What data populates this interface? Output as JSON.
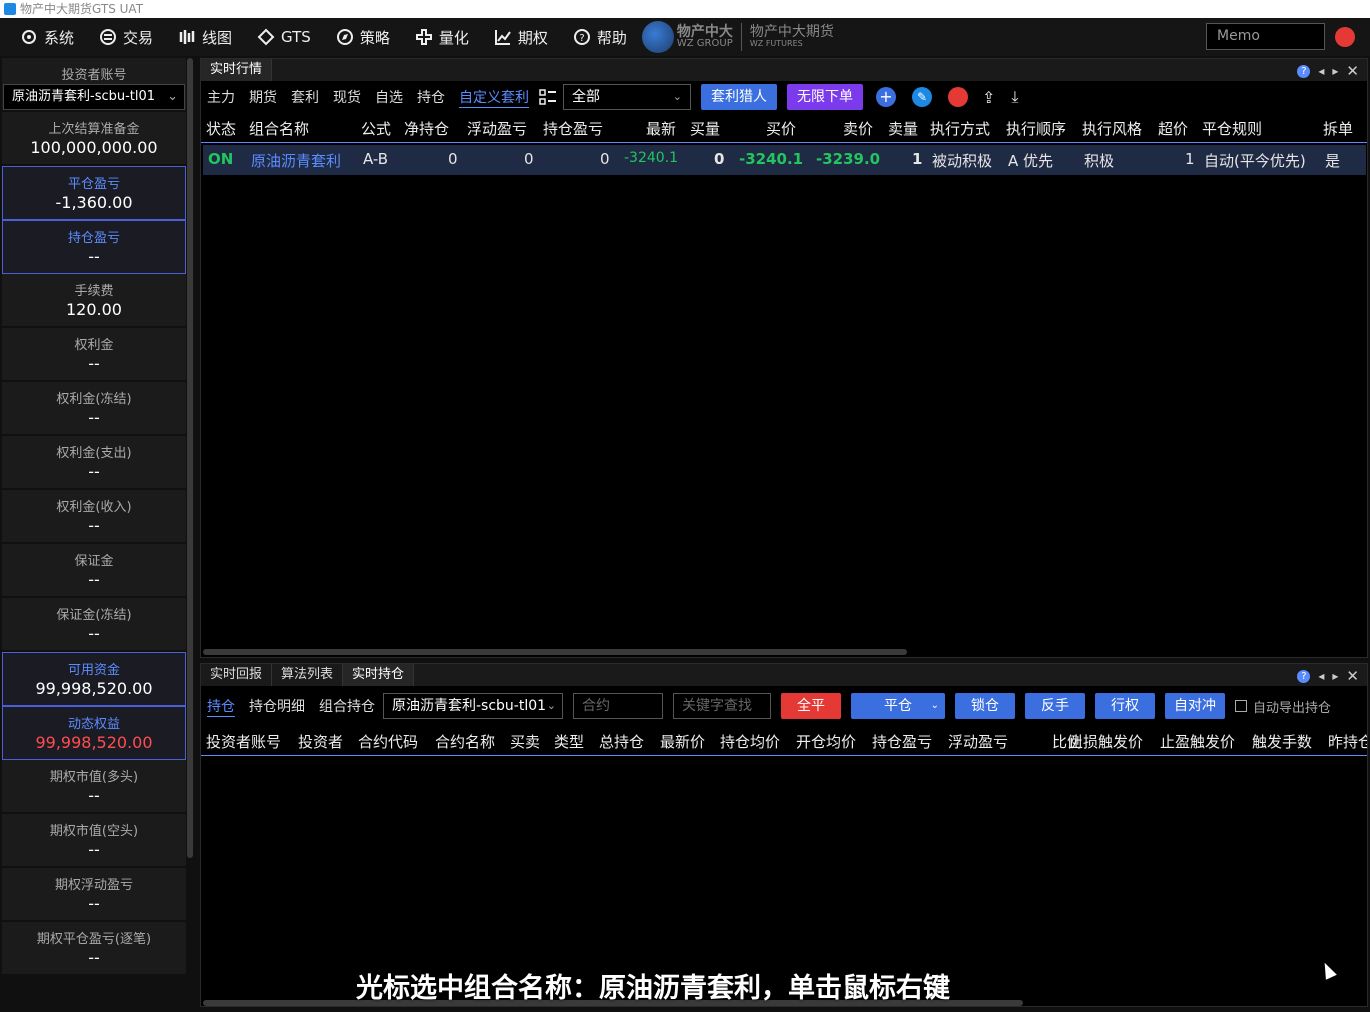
{
  "window": {
    "title": "物产中大期货GTS UAT"
  },
  "menu": [
    {
      "label": "系统",
      "icon": "gear-icon"
    },
    {
      "label": "交易",
      "icon": "exchange-icon"
    },
    {
      "label": "线图",
      "icon": "candlestick-icon"
    },
    {
      "label": "GTS",
      "icon": "diamond-icon"
    },
    {
      "label": "策略",
      "icon": "compass-icon"
    },
    {
      "label": "量化",
      "icon": "quant-icon"
    },
    {
      "label": "期权",
      "icon": "chart-line-icon"
    },
    {
      "label": "帮助",
      "icon": "help-icon"
    }
  ],
  "logo": {
    "name1": "物产中大",
    "sub1": "WZ GROUP",
    "name2": "物产中大期货",
    "sub2": "WZ FUTURES"
  },
  "memo": {
    "placeholder": "Memo"
  },
  "left": {
    "account_label": "投资者账号",
    "account_value": "原油沥青套利-scbu-tl01",
    "items": [
      {
        "label": "上次结算准备金",
        "value": "100,000,000.00"
      },
      {
        "label": "平仓盈亏",
        "value": "-1,360.00"
      },
      {
        "label": "持仓盈亏",
        "value": "--"
      },
      {
        "label": "手续费",
        "value": "120.00"
      },
      {
        "label": "权利金",
        "value": "--"
      },
      {
        "label": "权利金(冻结)",
        "value": "--"
      },
      {
        "label": "权利金(支出)",
        "value": "--"
      },
      {
        "label": "权利金(收入)",
        "value": "--"
      },
      {
        "label": "保证金",
        "value": "--"
      },
      {
        "label": "保证金(冻结)",
        "value": "--"
      },
      {
        "label": "可用资金",
        "value": "99,998,520.00"
      },
      {
        "label": "动态权益",
        "value": "99,998,520.00"
      },
      {
        "label": "期权市值(多头)",
        "value": "--"
      },
      {
        "label": "期权市值(空头)",
        "value": "--"
      },
      {
        "label": "期权浮动盈亏",
        "value": "--"
      },
      {
        "label": "期权平仓盈亏(逐笔)",
        "value": "--"
      }
    ]
  },
  "top_panel": {
    "tab": "实时行情",
    "filters": [
      "主力",
      "期货",
      "套利",
      "现货",
      "自选",
      "持仓",
      "自定义套利"
    ],
    "dropdown": "全部",
    "btn_hunter": "套利猎人",
    "btn_unlimited": "无限下单",
    "headers": [
      "状态",
      "组合名称",
      "公式",
      "净持仓",
      "浮动盈亏",
      "持仓盈亏",
      "最新",
      "买量",
      "买价",
      "卖价",
      "卖量",
      "执行方式",
      "执行顺序",
      "执行风格",
      "超价",
      "平仓规则",
      "拆单"
    ],
    "row": {
      "status": "ON",
      "name": "原油沥青套利",
      "formula": "A-B",
      "net": "0",
      "float": "0",
      "pos_pl": "0",
      "last": "-3240.1",
      "bid_vol": "0",
      "bid": "-3240.1",
      "ask": "-3239.0",
      "ask_vol": "1",
      "exec_mode": "被动积极",
      "exec_order": "A 优先",
      "exec_style": "积极",
      "over": "1",
      "close_rule": "自动(平今优先)",
      "split": "是"
    }
  },
  "bottom_panel": {
    "tabs": [
      "实时回报",
      "算法列表",
      "实时持仓"
    ],
    "filters": [
      "持仓",
      "持仓明细",
      "组合持仓"
    ],
    "account": "原油沥青套利-scbu-tl01",
    "contract_placeholder": "合约",
    "search_placeholder": "关键字查找",
    "btn_all_close": "全平",
    "btn_close": "平仓",
    "btn_lock": "锁仓",
    "btn_reverse": "反手",
    "btn_exercise": "行权",
    "btn_self_hedge": "自对冲",
    "auto_export": "自动导出持仓",
    "headers": [
      "投资者账号",
      "投资者",
      "合约代码",
      "合约名称",
      "买卖",
      "类型",
      "总持仓",
      "最新价",
      "持仓均价",
      "开仓均价",
      "持仓盈亏",
      "浮动盈亏",
      "比例",
      "止损触发价",
      "止盈触发价",
      "触发手数",
      "昨持仓"
    ]
  },
  "subtitle": "光标选中组合名称：原油沥青套利，单击鼠标右键",
  "colors": {
    "accent": "#5b8cff",
    "green": "#22c55e",
    "red": "#ff4d4f"
  }
}
